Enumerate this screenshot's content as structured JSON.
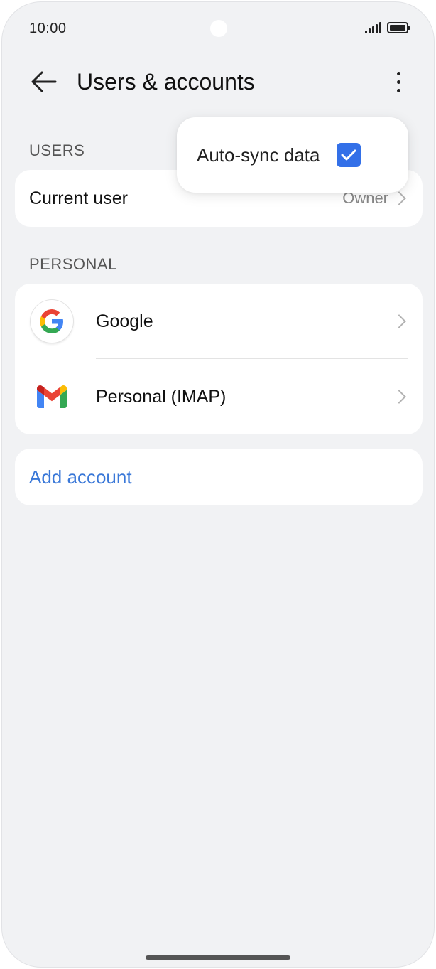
{
  "status_bar": {
    "time": "10:00"
  },
  "header": {
    "title": "Users & accounts"
  },
  "popup": {
    "label": "Auto-sync data",
    "checked": true
  },
  "users_section": {
    "label": "USERS",
    "current_user": {
      "label": "Current user",
      "value": "Owner"
    }
  },
  "personal_section": {
    "label": "PERSONAL",
    "accounts": [
      {
        "label": "Google",
        "icon": "google-icon"
      },
      {
        "label": "Personal (IMAP)",
        "icon": "gmail-icon"
      }
    ]
  },
  "add_account": {
    "label": "Add account"
  },
  "colors": {
    "accent": "#3370e8",
    "link": "#3a78d8",
    "background": "#f1f2f4",
    "card": "#ffffff"
  }
}
